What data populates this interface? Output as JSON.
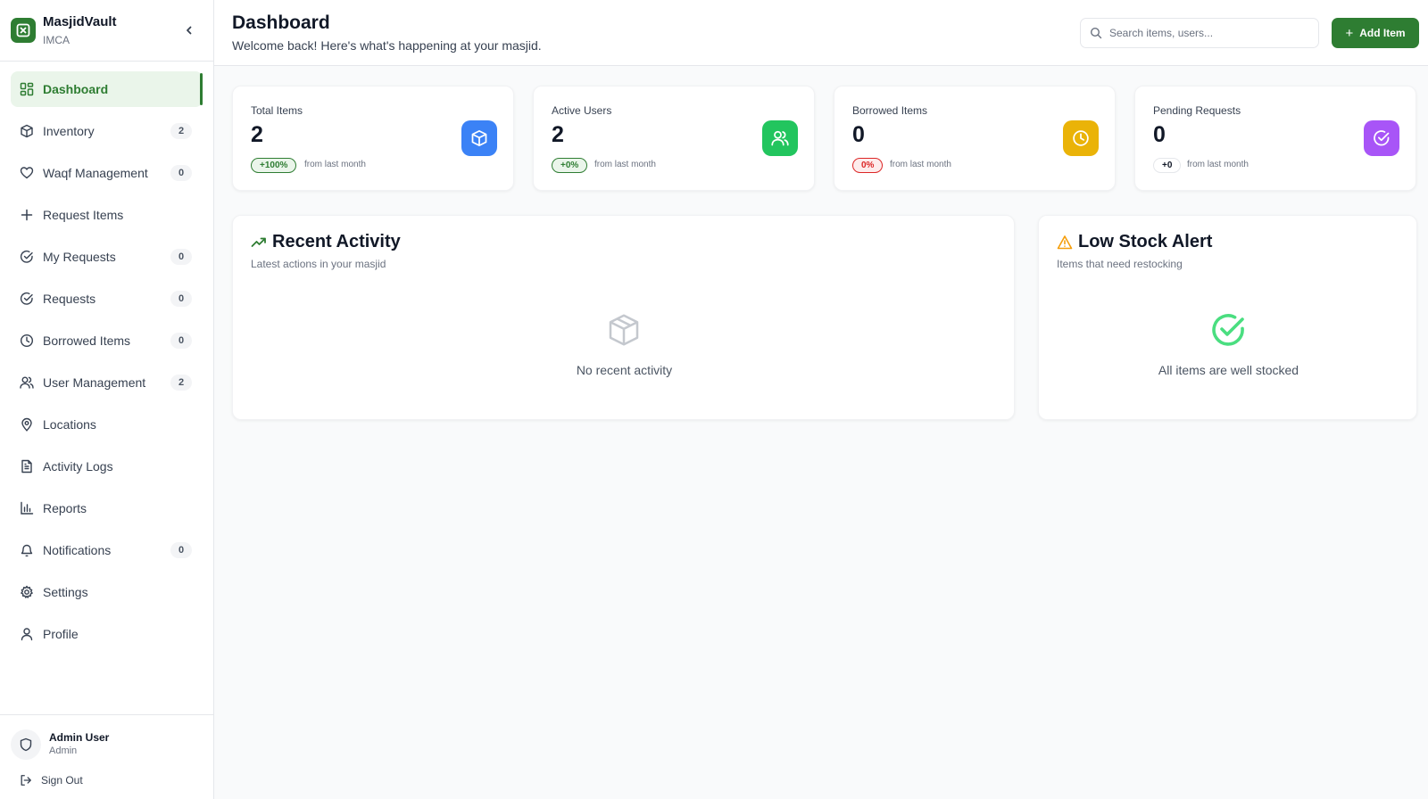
{
  "brand": {
    "name": "MasjidVault",
    "org": "IMCA"
  },
  "nav": [
    {
      "key": "dashboard",
      "label": "Dashboard",
      "badge": null,
      "active": true
    },
    {
      "key": "inventory",
      "label": "Inventory",
      "badge": "2"
    },
    {
      "key": "waqf",
      "label": "Waqf Management",
      "badge": "0"
    },
    {
      "key": "request-items",
      "label": "Request Items",
      "badge": null
    },
    {
      "key": "my-requests",
      "label": "My Requests",
      "badge": "0"
    },
    {
      "key": "requests",
      "label": "Requests",
      "badge": "0"
    },
    {
      "key": "borrowed",
      "label": "Borrowed Items",
      "badge": "0"
    },
    {
      "key": "users",
      "label": "User Management",
      "badge": "2"
    },
    {
      "key": "locations",
      "label": "Locations",
      "badge": null
    },
    {
      "key": "activity-logs",
      "label": "Activity Logs",
      "badge": null
    },
    {
      "key": "reports",
      "label": "Reports",
      "badge": null
    },
    {
      "key": "notifications",
      "label": "Notifications",
      "badge": "0"
    },
    {
      "key": "settings",
      "label": "Settings",
      "badge": null
    },
    {
      "key": "profile",
      "label": "Profile",
      "badge": null
    }
  ],
  "user": {
    "name": "Admin User",
    "role": "Admin",
    "sign_out": "Sign Out"
  },
  "header": {
    "title": "Dashboard",
    "subtitle": "Welcome back! Here's what's happening at your masjid.",
    "search_placeholder": "Search items, users...",
    "add_label": "Add Item"
  },
  "stats": [
    {
      "label": "Total Items",
      "value": "2",
      "change": "+100%",
      "note": "from last month",
      "icon": "box-icon",
      "color": "#3b82f6"
    },
    {
      "label": "Active Users",
      "value": "2",
      "change": "+0%",
      "note": "from last month",
      "icon": "users-icon",
      "color": "#22c55e"
    },
    {
      "label": "Borrowed Items",
      "value": "0",
      "change": "0%",
      "note": "from last month",
      "icon": "clock-icon",
      "color": "#eab308"
    },
    {
      "label": "Pending Requests",
      "value": "0",
      "change": "+0",
      "note": "from last month",
      "icon": "check-circle-icon",
      "color": "#a855f7"
    }
  ],
  "recent_activity": {
    "title": "Recent Activity",
    "subtitle": "Latest actions in your masjid",
    "empty": "No recent activity"
  },
  "low_stock": {
    "title": "Low Stock Alert",
    "subtitle": "Items that need restocking",
    "empty": "All items are well stocked"
  },
  "colors": {
    "brand": "#2e7d32",
    "brand_light": "#eaf5ea",
    "danger": "#dc2626",
    "warning": "#f59e0b"
  }
}
